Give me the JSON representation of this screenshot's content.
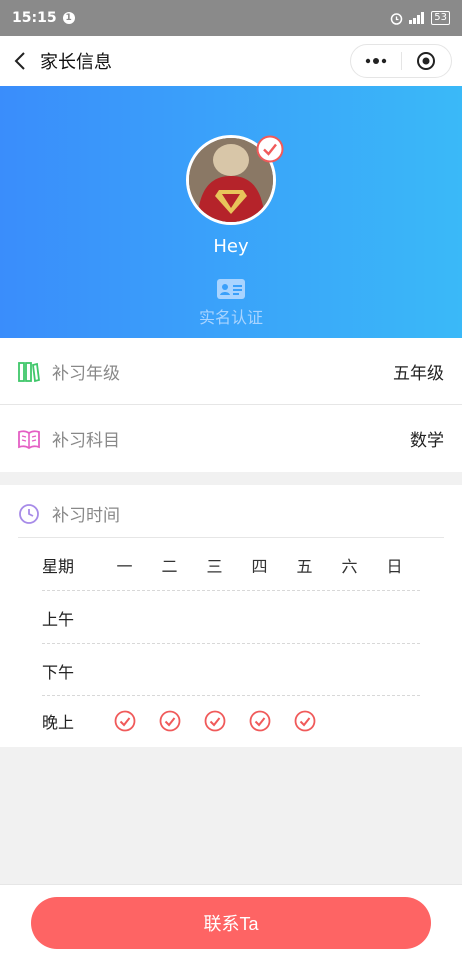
{
  "status_bar": {
    "time": "15:15",
    "notification_count": "1",
    "battery": "53"
  },
  "nav": {
    "title": "家长信息"
  },
  "profile": {
    "nickname": "Hey",
    "verification_label": "实名认证"
  },
  "grade": {
    "label": "补习年级",
    "value": "五年级"
  },
  "subject": {
    "label": "补习科目",
    "value": "数学"
  },
  "schedule": {
    "label": "补习时间",
    "header_label": "星期",
    "days": [
      "一",
      "二",
      "三",
      "四",
      "五",
      "六",
      "日"
    ],
    "rows": [
      {
        "label": "上午",
        "checked": [
          false,
          false,
          false,
          false,
          false,
          false,
          false
        ]
      },
      {
        "label": "下午",
        "checked": [
          false,
          false,
          false,
          false,
          false,
          false,
          false
        ]
      },
      {
        "label": "晚上",
        "checked": [
          true,
          true,
          true,
          true,
          true,
          false,
          false
        ]
      }
    ]
  },
  "contact": {
    "label": "联系Ta"
  },
  "colors": {
    "accent_gradient_start": "#3a8dfb",
    "accent_gradient_end": "#3ab9f8",
    "check_red": "#f05a5a",
    "button_red": "#fe6464"
  }
}
